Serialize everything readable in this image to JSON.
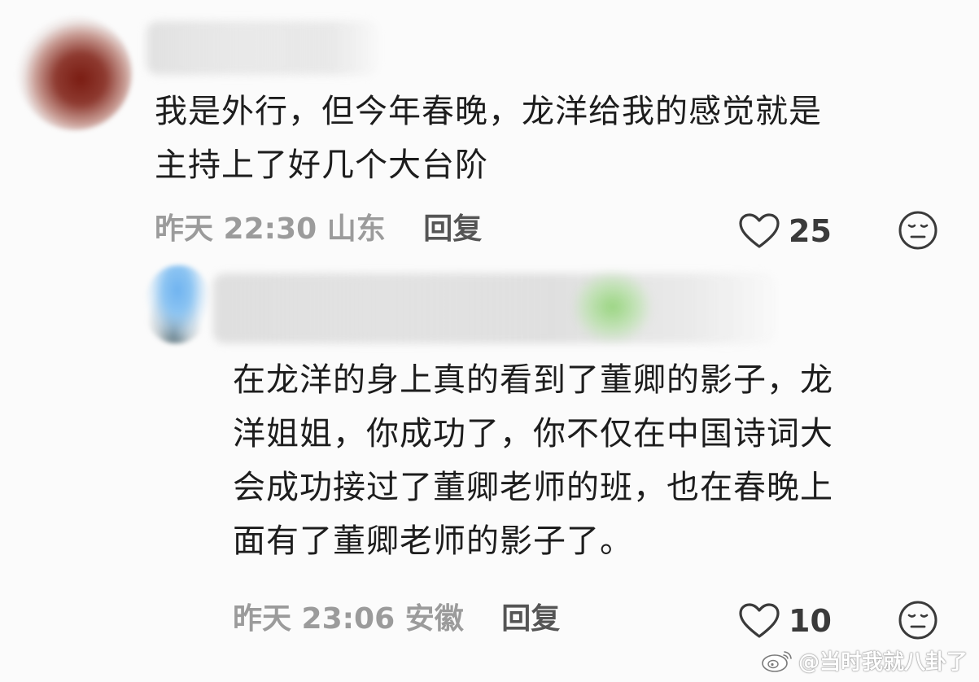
{
  "comments": [
    {
      "text_lines": [
        "我是外行，但今年春晚，龙洋给我的感觉就是",
        "主持上了好几个大台阶"
      ],
      "time": "昨天 22:30",
      "location": "山东",
      "reply_label": "回复",
      "likes": "25"
    },
    {
      "text_lines": [
        "在龙洋的身上真的看到了董卿的影子，龙",
        "洋姐姐，你成功了，你不仅在中国诗词大",
        "会成功接过了董卿老师的班，也在春晚上",
        "面有了董卿老师的影子了。"
      ],
      "time": "昨天 23:06",
      "location": "安徽",
      "reply_label": "回复",
      "likes": "10"
    }
  ],
  "watermark": {
    "text": "@当时我就八卦了"
  },
  "icons": {
    "like": "heart-outline-icon",
    "dislike": "unhappy-face-icon",
    "brand": "weibo-logo-icon"
  },
  "colors": {
    "text": "#1d1d1d",
    "meta": "#9b9b9b",
    "reply": "#555555",
    "icon": "#3a3a3a"
  }
}
